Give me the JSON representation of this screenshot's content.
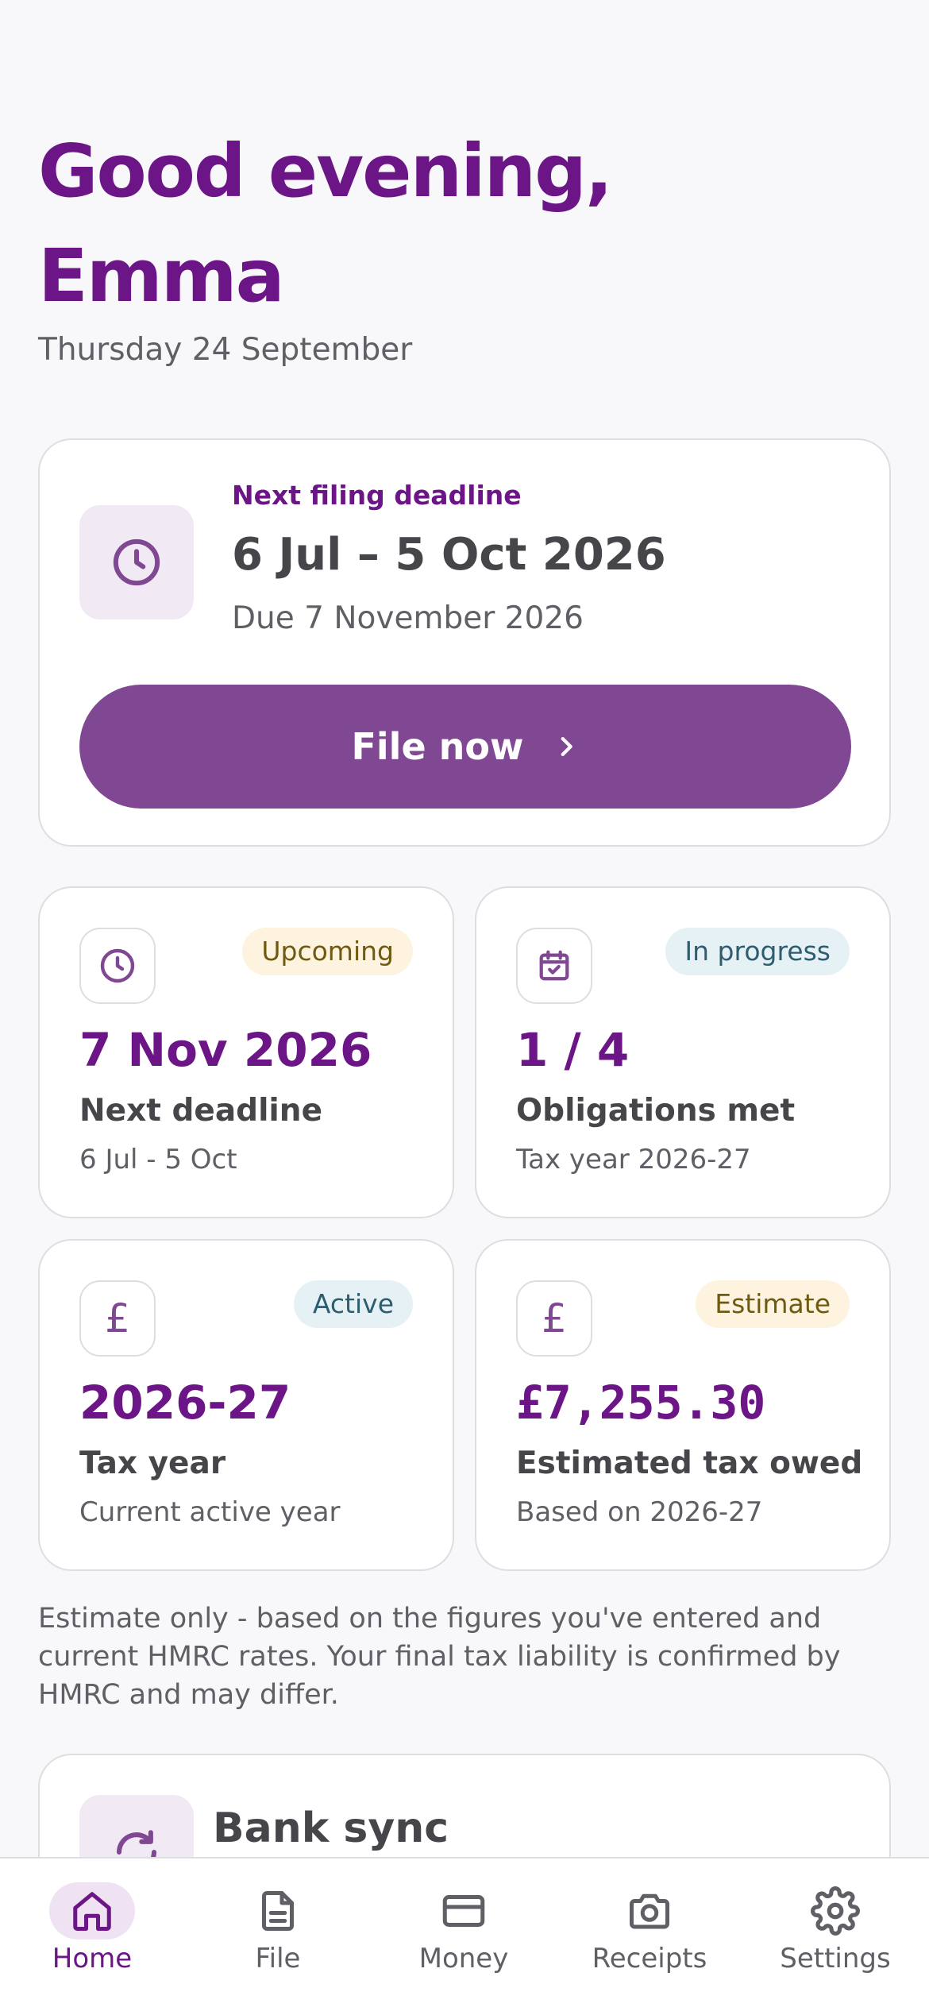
{
  "greeting": "Good evening, Emma",
  "date": "Thursday 24 September",
  "deadline_card": {
    "label": "Next filing deadline",
    "range": "6 Jul – 5 Oct 2026",
    "due": "Due 7 November 2026",
    "button_label": "File now",
    "icon": "clock-icon"
  },
  "stats": [
    {
      "icon": "clock-icon",
      "badge": "Upcoming",
      "value": "7 Nov 2026",
      "title": "Next deadline",
      "sub": "6 Jul - 5 Oct"
    },
    {
      "icon": "calendar-check-icon",
      "badge": "In progress",
      "value": "1 / 4",
      "title": "Obligations met",
      "sub": "Tax year 2026-27"
    },
    {
      "icon": "pound-icon",
      "badge": "Active",
      "value": "2026-27",
      "title": "Tax year",
      "sub": "Current active year"
    },
    {
      "icon": "pound-icon",
      "badge": "Estimate",
      "value": "£7,255.30",
      "title": "Estimated tax owed",
      "sub": "Based on 2026-27"
    }
  ],
  "disclaimer": "Estimate only - based on the figures you've entered and current HMRC rates. Your final tax liability is confirmed by HMRC and may differ.",
  "bank_sync": {
    "title": "Bank sync",
    "icon": "refresh-icon"
  },
  "tabs": [
    {
      "label": "Home",
      "icon": "home-icon",
      "active": true
    },
    {
      "label": "File",
      "icon": "document-icon",
      "active": false
    },
    {
      "label": "Money",
      "icon": "card-icon",
      "active": false
    },
    {
      "label": "Receipts",
      "icon": "camera-icon",
      "active": false
    },
    {
      "label": "Settings",
      "icon": "gear-icon",
      "active": false
    }
  ],
  "colors": {
    "brand": "#6b1587",
    "button": "#804793",
    "badge_amber_bg": "#fdf3de",
    "badge_blue_bg": "#e6f1f5"
  }
}
